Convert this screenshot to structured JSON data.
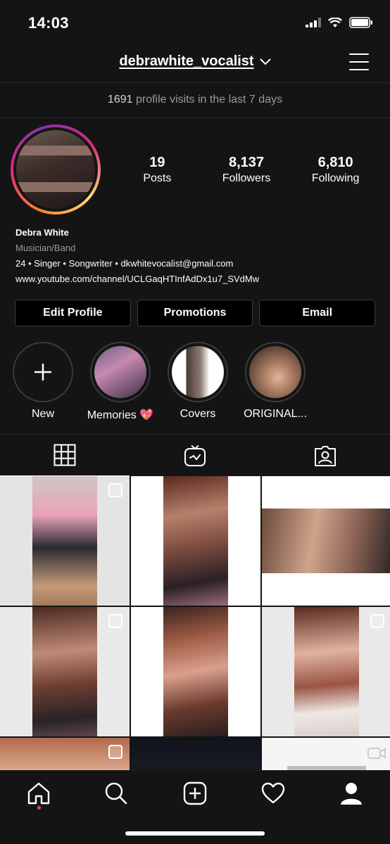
{
  "status_bar": {
    "time": "14:03"
  },
  "header": {
    "username": "debrawhite_vocalist"
  },
  "visits": {
    "count": "1691",
    "text": "profile visits in the last 7 days"
  },
  "stats": [
    {
      "value": "19",
      "label": "Posts"
    },
    {
      "value": "8,137",
      "label": "Followers"
    },
    {
      "value": "6,810",
      "label": "Following"
    }
  ],
  "bio": {
    "name": "Debra White",
    "category": "Musician/Band",
    "description": "24 • Singer • Songwriter • dkwhitevocalist@gmail.com",
    "link": "www.youtube.com/channel/UCLGaqHTInfAdDx1u7_SVdMw"
  },
  "buttons": {
    "edit": "Edit Profile",
    "promotions": "Promotions",
    "email": "Email"
  },
  "highlights": [
    {
      "label": "New",
      "kind": "add"
    },
    {
      "label": "Memories 💖",
      "kind": "story"
    },
    {
      "label": "Covers",
      "kind": "story"
    },
    {
      "label": "ORIGINAL...",
      "kind": "story"
    }
  ],
  "tabs": [
    "grid-icon",
    "igtv-icon",
    "tagged-icon"
  ],
  "grid_posts": 9,
  "colors": {
    "background": "#141414",
    "notification_dot": "#ed4956"
  }
}
